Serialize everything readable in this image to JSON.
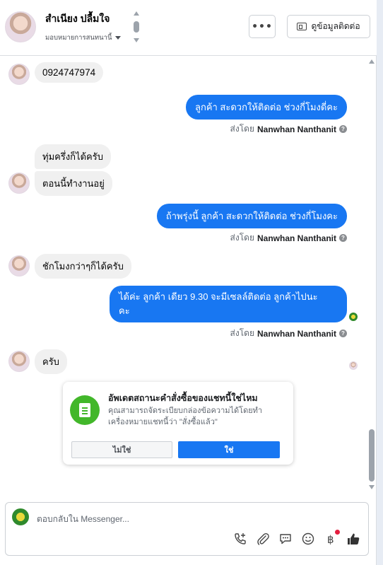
{
  "header": {
    "contact_name": "สำเนียง ปลื้มใจ",
    "assign_label": "มอบหมายการสนทนานี้",
    "more_label": "•••",
    "contact_info_label": "ดูข้อมูลติดต่อ"
  },
  "messages": [
    {
      "side": "in",
      "text": "0924747974"
    },
    {
      "side": "out",
      "text": "ลูกค้า สะดวกให้ติดต่อ ช่วงกี่โมงดี่คะ"
    },
    {
      "side": "in",
      "text": "ทุ่มครึ่งก็ได้ครับ"
    },
    {
      "side": "in",
      "text": "ตอนนี้ทำงานอยู่"
    },
    {
      "side": "out",
      "text": "ถ้าพรุ่งนี้ ลูกค้า สะดวกให้ติดต่อ ช่วงกี่โมงคะ"
    },
    {
      "side": "in",
      "text": "ชักโมงกว่าๆก็ได้ครับ"
    },
    {
      "side": "out",
      "line1": "ได้ค่ะ  ลูกค้า  เดียว 9.30 จะมีเซลล์ติดต่อ ลูกค้าไปนะ",
      "line2": "คะ"
    },
    {
      "side": "in",
      "text": "ครับ"
    }
  ],
  "sent_by": {
    "prefix": "ส่งโดย",
    "name": "Nanwhan Nanthanit",
    "help": "?"
  },
  "prompt": {
    "title": "อัพเดตสถานะคำสั่งซื้อของแชทนี้ใช่ไหม",
    "body": "คุณสามารถจัดระเบียบกล่องข้อความได้โดยทำเครื่องหมายแชทนี้ว่า \"สั่งซื้อแล้ว\"",
    "no_label": "ไม่ใช่",
    "yes_label": "ใช่"
  },
  "composer": {
    "placeholder": "ตอบกลับใน Messenger...",
    "tools": [
      "call-add-icon",
      "attachment-icon",
      "saved-replies-icon",
      "emoji-icon",
      "payment-icon",
      "like-icon"
    ]
  },
  "colors": {
    "accent": "#1877f2",
    "incoming_bubble": "#f0f0f0",
    "prompt_icon": "#42b72a"
  }
}
